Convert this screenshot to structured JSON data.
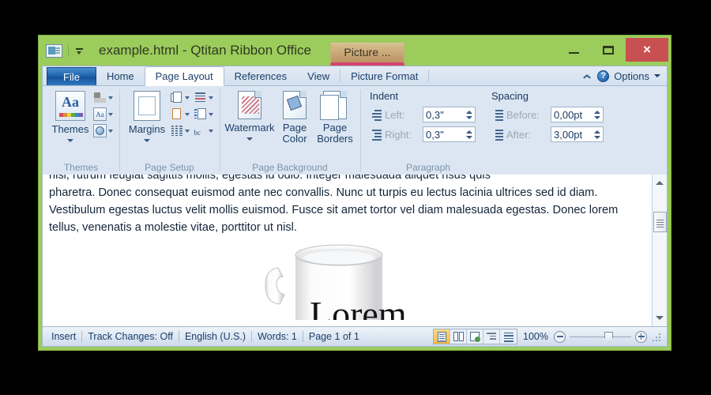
{
  "window": {
    "title": "example.html - Qtitan Ribbon Office",
    "app_icon": "application-icon",
    "qat_dropdown": "customize-quick-access-toolbar",
    "contextual_tab": "Picture ...",
    "minimize": "minimize",
    "maximize": "maximize",
    "close": "×",
    "chrome_color": "#9ccc5c",
    "close_color": "#c95050"
  },
  "tabs": [
    {
      "label": "File",
      "kind": "file"
    },
    {
      "label": "Home",
      "kind": "normal"
    },
    {
      "label": "Page Layout",
      "kind": "active"
    },
    {
      "label": "References",
      "kind": "normal"
    },
    {
      "label": "View",
      "kind": "normal"
    },
    {
      "label": "Picture Format",
      "kind": "contextual"
    }
  ],
  "tabbar_right": {
    "collapse": "collapse-ribbon",
    "help": "?",
    "options_label": "Options"
  },
  "ribbon": {
    "groups": [
      {
        "label": "Themes",
        "big": {
          "label": "Themes",
          "icon": "themes-icon",
          "has_caret": true
        },
        "small": [
          {
            "icon": "theme-colors-icon",
            "name": "theme-colors"
          },
          {
            "icon": "theme-fonts-icon",
            "name": "theme-fonts",
            "glyph": "Aa"
          },
          {
            "icon": "theme-effects-icon",
            "name": "theme-effects"
          }
        ]
      },
      {
        "label": "Page Setup",
        "big": {
          "label": "Margins",
          "icon": "margins-icon",
          "has_caret": true
        },
        "small": [
          {
            "icon": "orientation-icon",
            "name": "orientation"
          },
          {
            "icon": "breaks-icon",
            "name": "breaks"
          },
          {
            "icon": "size-icon",
            "name": "size"
          },
          {
            "icon": "line-numbers-icon",
            "name": "line-numbers"
          },
          {
            "icon": "columns-icon",
            "name": "columns"
          },
          {
            "icon": "hyphenation-icon",
            "name": "hyphenation",
            "glyph": "bc"
          }
        ]
      },
      {
        "label": "Page Background",
        "buttons": [
          {
            "label": "Watermark",
            "icon": "watermark-icon",
            "has_caret": true
          },
          {
            "label": "Page Color",
            "icon": "page-color-icon",
            "has_caret": true
          },
          {
            "label": "Page Borders",
            "icon": "page-borders-icon",
            "has_caret": false
          }
        ]
      },
      {
        "label": "Paragraph",
        "indent": {
          "title": "Indent",
          "left_label": "Left:",
          "left_value": "0,3\"",
          "right_label": "Right:",
          "right_value": "0,3\""
        },
        "spacing": {
          "title": "Spacing",
          "before_label": "Before:",
          "before_value": "0,00pt",
          "after_label": "After:",
          "after_value": "3,00pt"
        }
      }
    ]
  },
  "document": {
    "line_clipped": "nisl, rutrum feugiat sagittis mollis, egestas id odio. Integer malesuada aliquet risus quis",
    "paragraph": "pharetra. Donec consequat euismod ante nec convallis. Nunc ut turpis eu lectus lacinia ultrices sed id diam. Vestibulum egestas luctus velit mollis euismod. Fusce sit amet tortor vel diam malesuada egestas. Donec lorem tellus, venenatis a molestie vitae, porttitor ut nisl.",
    "image_caption": "Lorem",
    "image_name": "coffee-mug-image"
  },
  "scrollbar": {
    "up": "scroll-up",
    "down": "scroll-down",
    "thumb": "scroll-thumb"
  },
  "statusbar": {
    "items": [
      "Insert",
      "Track Changes: Off",
      "English (U.S.)",
      "Words: 1",
      "Page 1 of 1"
    ],
    "views": [
      {
        "name": "print-layout-view",
        "active": true
      },
      {
        "name": "full-screen-reading-view",
        "active": false
      },
      {
        "name": "web-layout-view",
        "active": false
      },
      {
        "name": "outline-view",
        "active": false
      },
      {
        "name": "draft-view",
        "active": false
      }
    ],
    "zoom_label": "100%",
    "zoom_out": "zoom-out",
    "zoom_in": "zoom-in",
    "zoom_value": 100
  }
}
